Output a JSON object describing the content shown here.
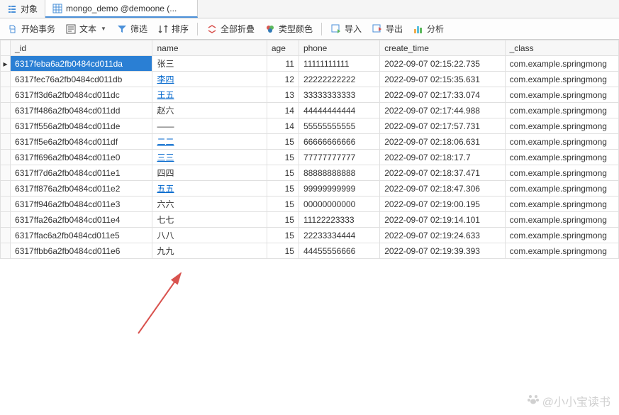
{
  "tabs": [
    {
      "label": "对象",
      "icon": "list"
    },
    {
      "label": "mongo_demo @demoone (...",
      "icon": "table"
    }
  ],
  "toolbar": {
    "start_transaction": "开始事务",
    "text": "文本",
    "filter": "筛选",
    "sort": "排序",
    "collapse_all": "全部折叠",
    "type_color": "类型颜色",
    "import": "导入",
    "export": "导出",
    "analyze": "分析"
  },
  "columns": [
    "_id",
    "name",
    "age",
    "phone",
    "create_time",
    "_class"
  ],
  "rows": [
    {
      "id": "6317feba6a2fb0484cd011da",
      "name": "张三",
      "age": "11",
      "phone": "11111111111",
      "create_time": "2022-09-07 02:15:22.735",
      "class": "com.example.springmong",
      "selected": true
    },
    {
      "id": "6317fec76a2fb0484cd011db",
      "name": "李四",
      "age": "12",
      "phone": "22222222222",
      "create_time": "2022-09-07 02:15:35.631",
      "class": "com.example.springmong",
      "link_name": true
    },
    {
      "id": "6317ff3d6a2fb0484cd011dc",
      "name": "王五",
      "age": "13",
      "phone": "33333333333",
      "create_time": "2022-09-07 02:17:33.074",
      "class": "com.example.springmong",
      "link_name": true
    },
    {
      "id": "6317ff486a2fb0484cd011dd",
      "name": "赵六",
      "age": "14",
      "phone": "44444444444",
      "create_time": "2022-09-07 02:17:44.988",
      "class": "com.example.springmong"
    },
    {
      "id": "6317ff556a2fb0484cd011de",
      "name": "——",
      "age": "14",
      "phone": "55555555555",
      "create_time": "2022-09-07 02:17:57.731",
      "class": "com.example.springmong"
    },
    {
      "id": "6317ff5e6a2fb0484cd011df",
      "name": "二二",
      "age": "15",
      "phone": "66666666666",
      "create_time": "2022-09-07 02:18:06.631",
      "class": "com.example.springmong",
      "link_name": true
    },
    {
      "id": "6317ff696a2fb0484cd011e0",
      "name": "三三",
      "age": "15",
      "phone": "77777777777",
      "create_time": "2022-09-07 02:18:17.7",
      "class": "com.example.springmong",
      "link_name": true
    },
    {
      "id": "6317ff7d6a2fb0484cd011e1",
      "name": "四四",
      "age": "15",
      "phone": "88888888888",
      "create_time": "2022-09-07 02:18:37.471",
      "class": "com.example.springmong"
    },
    {
      "id": "6317ff876a2fb0484cd011e2",
      "name": "五五",
      "age": "15",
      "phone": "99999999999",
      "create_time": "2022-09-07 02:18:47.306",
      "class": "com.example.springmong",
      "link_name": true
    },
    {
      "id": "6317ff946a2fb0484cd011e3",
      "name": "六六",
      "age": "15",
      "phone": "00000000000",
      "create_time": "2022-09-07 02:19:00.195",
      "class": "com.example.springmong"
    },
    {
      "id": "6317ffa26a2fb0484cd011e4",
      "name": "七七",
      "age": "15",
      "phone": "11122223333",
      "create_time": "2022-09-07 02:19:14.101",
      "class": "com.example.springmong"
    },
    {
      "id": "6317ffac6a2fb0484cd011e5",
      "name": "八八",
      "age": "15",
      "phone": "22233334444",
      "create_time": "2022-09-07 02:19:24.633",
      "class": "com.example.springmong"
    },
    {
      "id": "6317ffbb6a2fb0484cd011e6",
      "name": "九九",
      "age": "15",
      "phone": "44455556666",
      "create_time": "2022-09-07 02:19:39.393",
      "class": "com.example.springmong"
    }
  ],
  "watermark": "@小小宝读书"
}
